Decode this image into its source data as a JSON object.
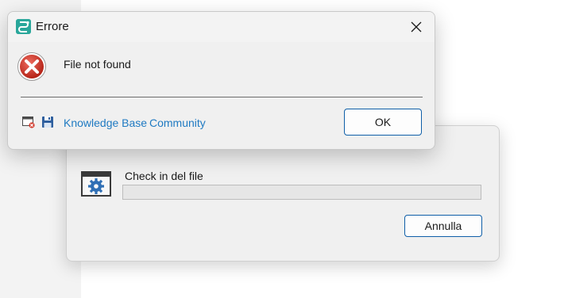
{
  "error_dialog": {
    "title": "Errore",
    "message": "File not found",
    "links": {
      "knowledge_base": "Knowledge Base",
      "community": "Community"
    },
    "ok_label": "OK",
    "icons": {
      "app": "app-logo-icon",
      "close": "close-icon",
      "error": "error-x-icon",
      "footer_left": "window-error-icon",
      "footer_right": "save-icon"
    }
  },
  "progress_dialog": {
    "label": "Check in del file",
    "progress": 0,
    "cancel_label": "Annulla",
    "icons": {
      "status": "window-gear-icon"
    }
  },
  "colors": {
    "accent": "#0f5fa8",
    "link": "#1f7ac2",
    "error_red": "#c42b1c"
  }
}
